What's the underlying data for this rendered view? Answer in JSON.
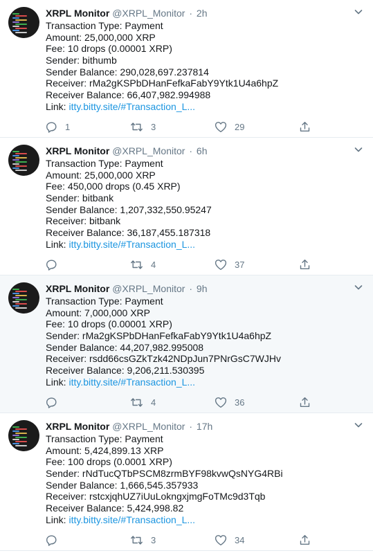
{
  "feed": {
    "tweets": [
      {
        "name": "XRPL Monitor",
        "handle": "@XRPL_Monitor",
        "separator": "·",
        "time": "2h",
        "highlighted": false,
        "lines": [
          "Transaction Type: Payment",
          "Amount: 25,000,000 XRP",
          "Fee: 10 drops (0.00001 XRP)",
          "Sender: bithumb",
          "Sender Balance: 290,028,697.237814",
          "Receiver: rMa2gKSPbDHanFefkaFabY9Ytk1U4a6hpZ",
          "Receiver Balance: 66,407,982.994988"
        ],
        "link_label": "Link: ",
        "link_text": "itty.bitty.site/#Transaction_L...",
        "replies": "1",
        "retweets": "3",
        "likes": "29"
      },
      {
        "name": "XRPL Monitor",
        "handle": "@XRPL_Monitor",
        "separator": "·",
        "time": "6h",
        "highlighted": false,
        "lines": [
          "Transaction Type: Payment",
          "Amount: 25,000,000 XRP",
          "Fee: 450,000 drops (0.45 XRP)",
          "Sender: bitbank",
          "Sender Balance: 1,207,332,550.95247",
          "Receiver: bitbank",
          "Receiver Balance: 36,187,455.187318"
        ],
        "link_label": "Link: ",
        "link_text": "itty.bitty.site/#Transaction_L...",
        "replies": "",
        "retweets": "4",
        "likes": "37"
      },
      {
        "name": "XRPL Monitor",
        "handle": "@XRPL_Monitor",
        "separator": "·",
        "time": "9h",
        "highlighted": true,
        "lines": [
          "Transaction Type: Payment",
          "Amount: 7,000,000 XRP",
          "Fee: 10 drops (0.00001 XRP)",
          "Sender: rMa2gKSPbDHanFefkaFabY9Ytk1U4a6hpZ",
          "Sender Balance: 44,207,982.995008",
          "Receiver: rsdd66csGZkTzk42NDpJun7PNrGsC7WJHv",
          "Receiver Balance: 9,206,211.530395"
        ],
        "link_label": "Link: ",
        "link_text": "itty.bitty.site/#Transaction_L...",
        "replies": "",
        "retweets": "4",
        "likes": "36"
      },
      {
        "name": "XRPL Monitor",
        "handle": "@XRPL_Monitor",
        "separator": "·",
        "time": "17h",
        "highlighted": false,
        "lines": [
          "Transaction Type: Payment",
          "Amount: 5,424,899.13 XRP",
          "Fee: 100 drops (0.0001 XRP)",
          "Sender: rNdTucQTbPSCM8zrmBYF98kvwQsNYG4RBi",
          "Sender Balance: 1,666,545.357933",
          "Receiver: rstcxjqhUZ7iUuLokngxjmgFoTMc9d3Tqb",
          "Receiver Balance: 5,424,998.82"
        ],
        "link_label": "Link: ",
        "link_text": "itty.bitty.site/#Transaction_L...",
        "replies": "",
        "retweets": "3",
        "likes": "34"
      }
    ]
  },
  "icons": {
    "reply": "reply-icon",
    "retweet": "retweet-icon",
    "like": "heart-icon",
    "share": "share-icon",
    "caret": "chevron-down-icon"
  },
  "colors": {
    "text": "#14171a",
    "muted": "#657786",
    "link": "#1b95e0",
    "divider": "#e6ecf0",
    "highlight_bg": "#f5f8fa",
    "avatar_bg": "#1b1b1b"
  }
}
